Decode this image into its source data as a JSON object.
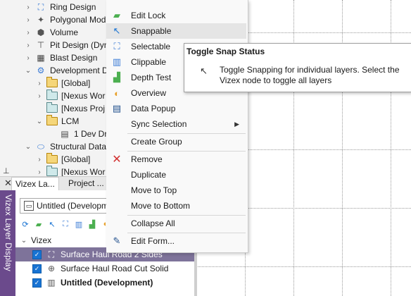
{
  "tree": {
    "items": [
      {
        "label": "Ring Design",
        "chevron": ">",
        "icon": "ring-design-icon"
      },
      {
        "label": "Polygonal Mod",
        "chevron": ">",
        "icon": "polygonal-model-icon"
      },
      {
        "label": "Volume",
        "chevron": ">",
        "icon": "volume-icon"
      },
      {
        "label": "Pit Design (Dyn",
        "chevron": ">",
        "icon": "pit-design-icon"
      },
      {
        "label": "Blast Design",
        "chevron": ">",
        "icon": "blast-design-icon"
      },
      {
        "label": "Development D",
        "chevron": "v",
        "icon": "development-icon"
      },
      {
        "label": "[Global]",
        "chevron": ">",
        "icon": "folder-icon"
      },
      {
        "label": "[Nexus Wor",
        "chevron": ">",
        "icon": "folder-icon"
      },
      {
        "label": "[Nexus Proj",
        "chevron": "",
        "icon": "folder-icon"
      },
      {
        "label": "LCM",
        "chevron": "v",
        "icon": "folder-icon"
      },
      {
        "label": "1 Dev Dr",
        "chevron": "",
        "icon": "grid-icon"
      },
      {
        "label": "Structural Data",
        "chevron": "v",
        "icon": "structural-data-icon"
      },
      {
        "label": "[Global]",
        "chevron": ">",
        "icon": "folder-icon"
      },
      {
        "label": "[Nexus Wor",
        "chevron": ">",
        "icon": "folder-icon"
      }
    ]
  },
  "tabs": [
    {
      "label": "Vizex La..."
    },
    {
      "label": "Project ..."
    }
  ],
  "panel": {
    "sidebar_title": "Vizex Layer Display",
    "combo_value": "Untitled (Developm",
    "root_label": "Vizex",
    "layers": [
      {
        "label": "Surface Haul Road 2 Sides",
        "checked": true,
        "selected": true
      },
      {
        "label": "Surface Haul Road Cut Solid",
        "checked": true,
        "selected": false
      },
      {
        "label": "Untitled (Development)",
        "checked": true,
        "selected": false,
        "bold": true
      }
    ]
  },
  "menu": {
    "items": [
      {
        "label": "Edit Lock",
        "icon": "edit-lock-icon"
      },
      {
        "label": "Snappable",
        "icon": "snappable-icon",
        "highlighted": true
      },
      {
        "label": "Selectable",
        "icon": "selectable-icon"
      },
      {
        "label": "Clippable",
        "icon": "clippable-icon"
      },
      {
        "label": "Depth Test",
        "icon": "depth-test-icon"
      },
      {
        "label": "Overview",
        "icon": "overview-icon"
      },
      {
        "label": "Data Popup",
        "icon": "data-popup-icon"
      },
      {
        "label": "Sync Selection",
        "icon": "",
        "submenu": true
      },
      {
        "label": "Create Group",
        "icon": ""
      },
      {
        "label": "Remove",
        "icon": "remove-icon"
      },
      {
        "label": "Duplicate",
        "icon": ""
      },
      {
        "label": "Move to Top",
        "icon": ""
      },
      {
        "label": "Move to Bottom",
        "icon": ""
      },
      {
        "label": "Collapse All",
        "icon": ""
      },
      {
        "label": "Edit Form...",
        "icon": "edit-form-icon"
      }
    ]
  },
  "tooltip": {
    "title": "Toggle Snap Status",
    "body": "Toggle Snapping for individual layers. Select the Vizex node to toggle all layers"
  },
  "colors": {
    "selection": "#7e739a",
    "sidebar": "#6b4a8c",
    "checkbox": "#1873d3",
    "remove": "#d23030"
  }
}
